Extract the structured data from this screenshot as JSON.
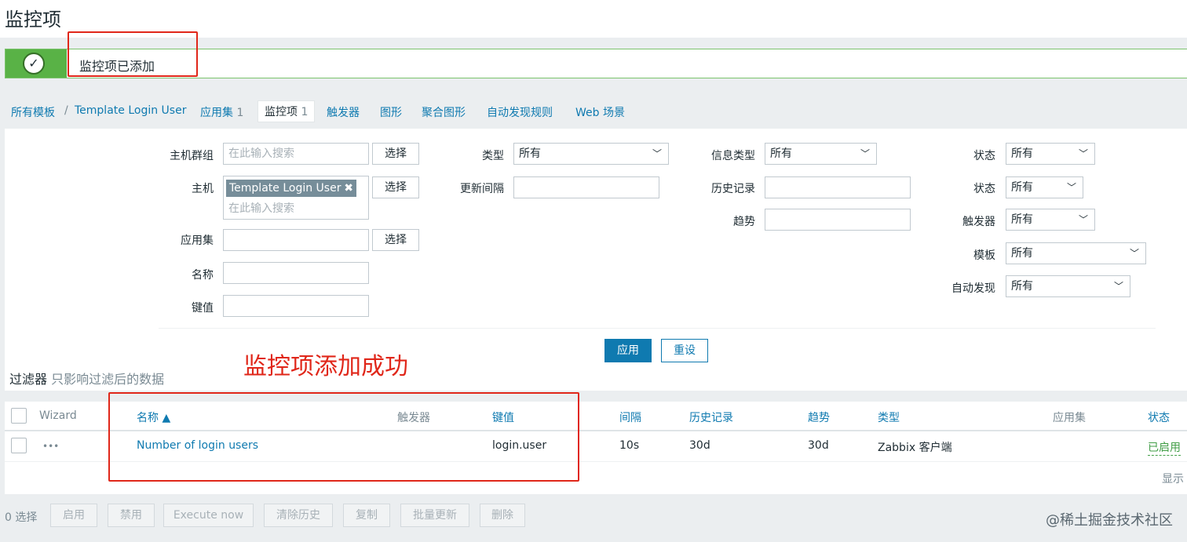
{
  "page": {
    "title": "监控项"
  },
  "message": {
    "text": "监控项已添加",
    "icon": "check-circle-icon"
  },
  "nav": {
    "breadcrumb_root": "所有模板",
    "separator": "/",
    "breadcrumb_template": "Template Login User",
    "applications": {
      "label": "应用集",
      "count": "1"
    },
    "items": {
      "label": "监控项",
      "count": "1"
    },
    "triggers": "触发器",
    "graphs": "图形",
    "screens": "聚合图形",
    "discovery": "自动发现规则",
    "web": "Web 场景"
  },
  "filter": {
    "host_group_label": "主机群组",
    "host_group_placeholder": "在此输入搜索",
    "select_label": "选择",
    "host_label": "主机",
    "host_tag": "Template Login User",
    "host_placeholder": "在此输入搜索",
    "app_label": "应用集",
    "name_label": "名称",
    "key_label": "键值",
    "type_label": "类型",
    "type_value": "所有",
    "update_interval_label": "更新间隔",
    "info_type_label": "信息类型",
    "info_type_value": "所有",
    "history_label": "历史记录",
    "trends_label": "趋势",
    "status_label": "状态",
    "status_value": "所有",
    "state_label": "状态",
    "state_value": "所有",
    "triggers_label": "触发器",
    "triggers_value": "所有",
    "template_label": "模板",
    "template_value": "所有",
    "discovery_label": "自动发现",
    "discovery_value": "所有",
    "apply_label": "应用",
    "reset_label": "重设",
    "tab_label": "过滤器",
    "tab_sub": "只影响过滤后的数据"
  },
  "annotation": {
    "text": "监控项添加成功"
  },
  "table": {
    "headers": {
      "wizard": "Wizard",
      "name": "名称 ▲",
      "triggers": "触发器",
      "key": "键值",
      "interval": "间隔",
      "history": "历史记录",
      "trends": "趋势",
      "type": "类型",
      "applications": "应用集",
      "status": "状态"
    },
    "rows": [
      {
        "wizard": "•••",
        "name": "Number of login users",
        "key": "login.user",
        "interval": "10s",
        "history": "30d",
        "trends": "30d",
        "type": "Zabbix 客户端",
        "status": "已启用"
      }
    ],
    "footer": "显示"
  },
  "actions": {
    "selected": "0 选择",
    "enable": "启用",
    "disable": "禁用",
    "execute_now": "Execute now",
    "clear_history": "清除历史",
    "copy": "复制",
    "mass_update": "批量更新",
    "delete": "删除"
  },
  "watermark": "@稀土掘金技术社区"
}
